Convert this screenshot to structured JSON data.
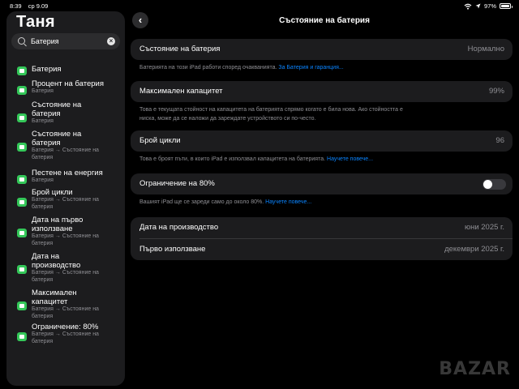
{
  "status_bar": {
    "time": "8:39",
    "date": "ср 9.09",
    "battery_percent": "97%",
    "battery_level": 0.97
  },
  "sidebar": {
    "title": "Таня",
    "search": {
      "value": "Батерия"
    },
    "results": [
      {
        "title": "Батерия",
        "subtitle": ""
      },
      {
        "title": "Процент на батерия",
        "subtitle": "Батерия"
      },
      {
        "title": "Състояние на батерия",
        "subtitle": "Батерия"
      },
      {
        "title": "Състояние на батерия",
        "subtitle": "Батерия → Състояние на батерия"
      },
      {
        "title": "Пестене на енергия",
        "subtitle": "Батерия"
      },
      {
        "title": "Брой цикли",
        "subtitle": "Батерия → Състояние на батерия"
      },
      {
        "title": "Дата на първо използване",
        "subtitle": "Батерия → Състояние на батерия"
      },
      {
        "title": "Дата на производство",
        "subtitle": "Батерия → Състояние на батерия"
      },
      {
        "title": "Максимален капацитет",
        "subtitle": "Батерия → Състояние на батерия"
      },
      {
        "title": "Ограничение: 80%",
        "subtitle": "Батерия → Състояние на батерия"
      }
    ]
  },
  "header": {
    "title": "Състояние на батерия"
  },
  "main": {
    "health": {
      "label": "Състояние на батерия",
      "value": "Нормално",
      "note": "Батерията на този iPad работи според очакванията.",
      "link": "За Батерия и гаранция..."
    },
    "capacity": {
      "label": "Максимален капацитет",
      "value": "99%",
      "note_line1": "Това е текущата стойност на капацитета на батерията спрямо когато е била нова. Ако стойността е",
      "note_line2": "ниска, може да се наложи да зареждате устройството си по-често."
    },
    "cycles": {
      "label": "Брой цикли",
      "value": "96",
      "note": "Това е броят пъти, в които iPad е използвал капацитета на батерията.",
      "link": "Научете повече..."
    },
    "limit": {
      "label": "Ограничение на 80%",
      "enabled": false,
      "note": "Вашият iPad ще се зареди само до около 80%.",
      "link": "Научете повече..."
    },
    "dates": {
      "manufacture_label": "Дата на производство",
      "manufacture_value": "юни 2025 г.",
      "first_use_label": "Първо използване",
      "first_use_value": "декември 2025 г."
    }
  },
  "watermark": "BAZAR"
}
